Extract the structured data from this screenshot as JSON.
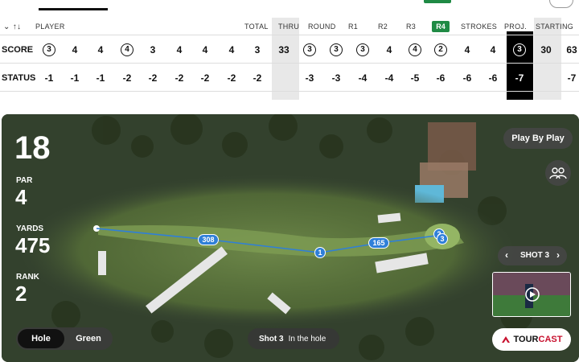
{
  "scorecard": {
    "headers": {
      "player": "PLAYER",
      "total": "TOTAL",
      "thru": "THRU",
      "round": "ROUND",
      "r1": "R1",
      "r2": "R2",
      "r3": "R3",
      "r4": "R4",
      "strokes": "STROKES",
      "proj": "PROJ.",
      "starting": "STARTING"
    },
    "score_label": "SCORE",
    "status_label": "STATUS",
    "score_row": [
      "3",
      "4",
      "4",
      "4",
      "3",
      "4",
      "4",
      "4",
      "3",
      "33",
      "3",
      "3",
      "3",
      "4",
      "4",
      "2",
      "4",
      "4",
      "3",
      "30",
      "63"
    ],
    "status_row": [
      "-1",
      "-1",
      "-1",
      "-2",
      "-2",
      "-2",
      "-2",
      "-2",
      "-2",
      "",
      "-3",
      "-3",
      "-4",
      "-4",
      "-5",
      "-6",
      "-6",
      "-6",
      "-7",
      "",
      "-7"
    ]
  },
  "hole": {
    "number": "18",
    "par_label": "PAR",
    "par": "4",
    "yards_label": "YARDS",
    "yards": "475",
    "rank_label": "RANK",
    "rank": "2"
  },
  "controls": {
    "play_by_play": "Play By Play",
    "shot_nav": "SHOT 3",
    "toggle_hole": "Hole",
    "toggle_green": "Green",
    "shot_status_shot": "Shot 3",
    "shot_status_text": "In the hole",
    "tourcast_a": "TOUR",
    "tourcast_b": "CAST"
  },
  "shot_markers": {
    "m308": "308",
    "m1": "1",
    "m165": "165",
    "m2": "2",
    "m3": "3"
  },
  "colors": {
    "accent_blue": "#2f7fd8",
    "r4_green": "#1f8a44",
    "tourcast_red": "#c8102e"
  }
}
